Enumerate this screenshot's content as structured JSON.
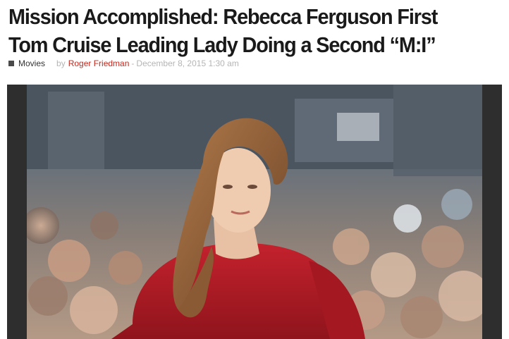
{
  "article": {
    "title": "Mission Accomplished: Rebecca Ferguson First Tom Cruise Leading Lady Doing a Second “M:I”",
    "category": "Movies",
    "by_label": "by",
    "author": "Roger Friedman",
    "separator": "-",
    "date": "December 8, 2015 1:30 am"
  },
  "image": {
    "subject": "woman-in-red-dress-photo"
  },
  "colors": {
    "author_link": "#c0291e",
    "meta_gray": "#b5b5b5",
    "title": "#1a1a1a"
  }
}
